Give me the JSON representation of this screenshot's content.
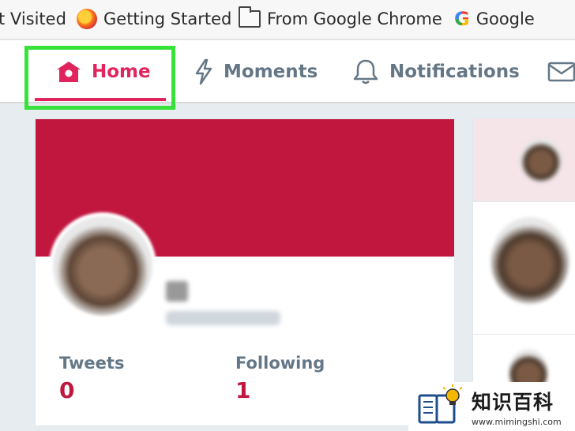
{
  "bookmarks": [
    {
      "label": "t Visited"
    },
    {
      "label": "Getting Started",
      "icon": "firefox-icon"
    },
    {
      "label": "From Google Chrome",
      "icon": "folder-icon"
    },
    {
      "label": "Google",
      "icon": "google-icon",
      "glyph": "G"
    }
  ],
  "nav": {
    "home": "Home",
    "moments": "Moments",
    "notifications": "Notifications",
    "messages_icon": "mail-icon"
  },
  "colors": {
    "accent": "#e0245e",
    "banner": "#c1173f",
    "highlight": "#39e23a",
    "muted": "#657786"
  },
  "profile": {
    "tweets_label": "Tweets",
    "tweets_value": "0",
    "following_label": "Following",
    "following_value": "1"
  },
  "watermark": {
    "title": "知识百科",
    "url": "www.mimingshi.com"
  }
}
